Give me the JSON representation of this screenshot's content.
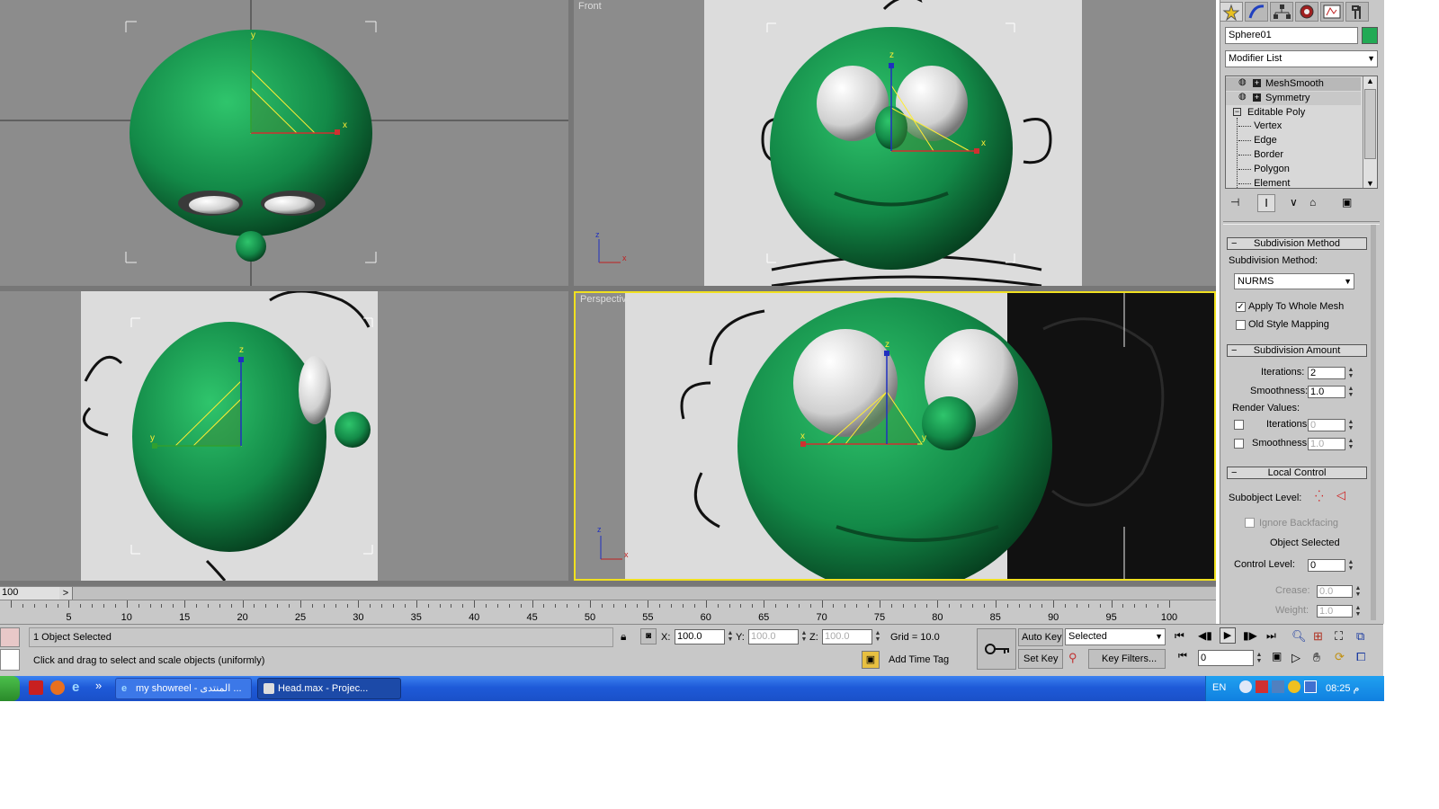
{
  "viewports": {
    "top": {
      "label": ""
    },
    "front": {
      "label": "Front"
    },
    "left": {
      "label": ""
    },
    "perspective": {
      "label": "Perspective"
    },
    "axes": {
      "x": "x",
      "y": "y",
      "z": "z"
    }
  },
  "command_panel": {
    "object_name": "Sphere01",
    "object_color": "#22aa55",
    "modifier_list_label": "Modifier List",
    "stack": [
      {
        "label": "MeshSmooth",
        "selected": true
      },
      {
        "label": "Symmetry",
        "selected": false
      },
      {
        "label": "Editable Poly",
        "selected": false
      },
      {
        "label": "Vertex"
      },
      {
        "label": "Edge"
      },
      {
        "label": "Border"
      },
      {
        "label": "Polygon"
      },
      {
        "label": "Element"
      }
    ],
    "subdivision_method_rollout": "Subdivision Method",
    "subdivision_method_label": "Subdivision Method:",
    "subdivision_method_value": "NURMS",
    "apply_whole_mesh": "Apply To Whole Mesh",
    "old_style_mapping": "Old Style Mapping",
    "subdivision_amount_rollout": "Subdivision Amount",
    "iterations_label": "Iterations:",
    "iterations_value": "2",
    "smoothness_label": "Smoothness:",
    "smoothness_value": "1.0",
    "render_values_label": "Render Values:",
    "render_iterations_label": "Iterations:",
    "render_iterations_value": "0",
    "render_smoothness_label": "Smoothness:",
    "render_smoothness_value": "1.0",
    "local_control_rollout": "Local Control",
    "subobject_level_label": "Subobject Level:",
    "ignore_backfacing": "Ignore Backfacing",
    "object_selected": "Object Selected",
    "control_level_label": "Control Level:",
    "control_level_value": "0",
    "crease_label": "Crease:",
    "crease_value": "0.0",
    "weight_label": "Weight:",
    "weight_value": "1.0",
    "minus": "−"
  },
  "timeline": {
    "slider_value": "100",
    "slider_arrow": ">",
    "ticks": [
      "5",
      "10",
      "15",
      "20",
      "25",
      "30",
      "35",
      "40",
      "45",
      "50",
      "55",
      "60",
      "65",
      "70",
      "75",
      "80",
      "85",
      "90",
      "95",
      "100"
    ]
  },
  "status": {
    "selection_text": "1 Object Selected",
    "prompt_text": "Click and drag to select and scale objects (uniformly)",
    "x_label": "X:",
    "x_value": "100.0",
    "y_label": "Y:",
    "y_value": "100.0",
    "z_label": "Z:",
    "z_value": "100.0",
    "grid_text": "Grid = 10.0",
    "add_time_tag": "Add Time Tag",
    "auto_key": "Auto Key",
    "key_mode": "Selected",
    "set_key": "Set Key",
    "key_filters": "Key Filters...",
    "frame_value": "0"
  },
  "taskbar": {
    "task1": "my showreel - المنتدى ...",
    "task2": "Head.max     - Projec...",
    "chevron": "»",
    "lang": "EN",
    "clock": "08:25 م"
  }
}
